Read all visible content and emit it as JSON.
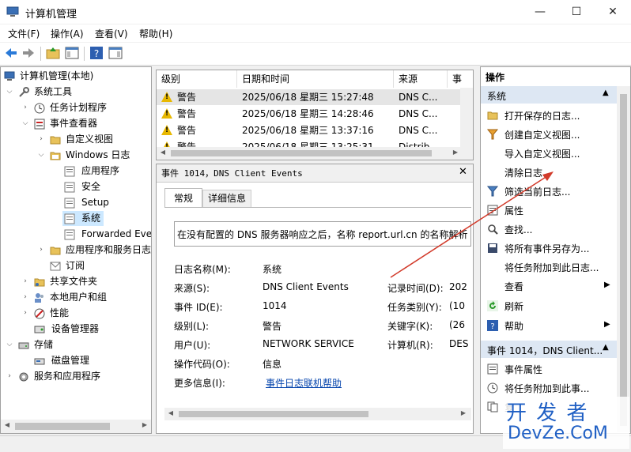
{
  "window": {
    "title": "计算机管理",
    "min": "—",
    "max": "☐",
    "close": "✕"
  },
  "menu": [
    "文件(F)",
    "操作(A)",
    "查看(V)",
    "帮助(H)"
  ],
  "tree": {
    "root": "计算机管理(本地)",
    "system_tools": "系统工具",
    "task_scheduler": "任务计划程序",
    "event_viewer": "事件查看器",
    "custom_views": "自定义视图",
    "windows_logs": "Windows 日志",
    "application": "应用程序",
    "security": "安全",
    "setup": "Setup",
    "system": "系统",
    "forwarded": "Forwarded Eve",
    "app_services_logs": "应用程序和服务日志",
    "subscriptions": "订阅",
    "shared_folders": "共享文件夹",
    "local_users": "本地用户和组",
    "performance": "性能",
    "device_manager": "设备管理器",
    "storage": "存储",
    "disk_management": "磁盘管理",
    "services_apps": "服务和应用程序"
  },
  "events_table": {
    "headers": [
      "级别",
      "日期和时间",
      "来源",
      "事"
    ],
    "rows": [
      {
        "level": "警告",
        "datetime": "2025/06/18 星期三 15:27:48",
        "source": "DNS C..."
      },
      {
        "level": "警告",
        "datetime": "2025/06/18 星期三 14:28:46",
        "source": "DNS C..."
      },
      {
        "level": "警告",
        "datetime": "2025/06/18 星期三 13:37:16",
        "source": "DNS C..."
      },
      {
        "level": "警告",
        "datetime": "2025/06/18 星期三 13:25:31",
        "source": "Distrib..."
      }
    ]
  },
  "detail": {
    "title": "事件 1014，DNS Client Events",
    "tab_general": "常规",
    "tab_details": "详细信息",
    "message": "在没有配置的 DNS 服务器响应之后，名称 report.url.cn 的名称解析",
    "fields": {
      "log_name_label": "日志名称(M):",
      "log_name": "系统",
      "source_label": "来源(S):",
      "source": "DNS Client Events",
      "logged_label": "记录时间(D):",
      "logged": "202",
      "event_id_label": "事件 ID(E):",
      "event_id": "1014",
      "task_category_label": "任务类别(Y):",
      "task_category": "(10",
      "level_label": "级别(L):",
      "level": "警告",
      "keywords_label": "关键字(K):",
      "keywords": "(26",
      "user_label": "用户(U):",
      "user": "NETWORK SERVICE",
      "computer_label": "计算机(R):",
      "computer": "DES",
      "opcode_label": "操作代码(O):",
      "opcode": "信息",
      "more_info_label": "更多信息(I):",
      "more_info_link": "事件日志联机帮助"
    }
  },
  "actions": {
    "header": "操作",
    "system_section": "系统",
    "items": [
      "打开保存的日志...",
      "创建自定义视图...",
      "导入自定义视图...",
      "清除日志...",
      "筛选当前日志...",
      "属性",
      "查找...",
      "将所有事件另存为...",
      "将任务附加到此日志...",
      "查看",
      "刷新",
      "帮助"
    ],
    "event_section": "事件 1014，DNS Client...",
    "event_items": [
      "事件属性",
      "将任务附加到此事...",
      "复"
    ]
  },
  "watermark": {
    "line1": "开 发 者",
    "line2": "DevZe.CoM"
  }
}
